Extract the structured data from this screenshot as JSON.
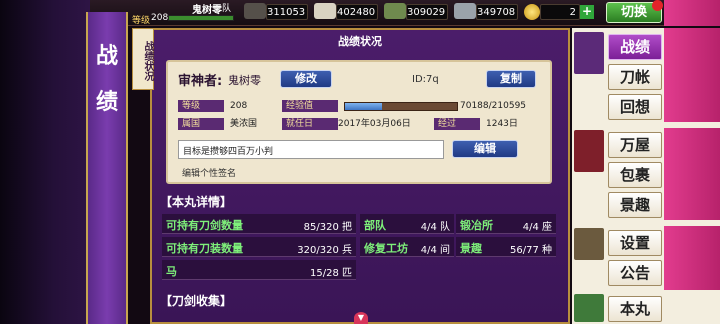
{
  "header": {
    "player_name": "鬼树零",
    "level_label": "等级",
    "level": "208",
    "resources": [
      "311053",
      "402480",
      "309029",
      "349708"
    ],
    "coins": "2",
    "switch_label": "切换"
  },
  "banner": {
    "line1": "战",
    "line2": "绩"
  },
  "panel": {
    "title": "战绩状况",
    "side_tag": "战绩状况"
  },
  "profile": {
    "name_label": "审神者:",
    "name": "鬼树零",
    "modify_button": "修改",
    "id": "ID:7q",
    "copy_button": "复制",
    "level_label": "等级",
    "level": "208",
    "exp_label": "经验值",
    "exp": "70188/210595",
    "exp_progress": 0.333,
    "country_label": "属国",
    "country": "美浓国",
    "appointed_label": "就任日",
    "appointed": "2017年03月06日",
    "elapsed_label": "经过",
    "elapsed": "1243日",
    "signature": "目标是攒够四百万小判",
    "edit_button": "编辑",
    "signature_hint": "编辑个性签名"
  },
  "details": {
    "section_title": "【本丸详情】",
    "rows": [
      {
        "key": "可持有刀剑数量",
        "value": "85/320 把"
      },
      {
        "key": "可持有刀装数量",
        "value": "320/320 兵"
      },
      {
        "key": "马",
        "value": "15/28 匹"
      }
    ],
    "rows2": [
      {
        "key": "部队",
        "value": "4/4 队"
      },
      {
        "key": "修复工坊",
        "value": "4/4 间"
      }
    ],
    "rows3": [
      {
        "key": "锻冶所",
        "value": "4/4 座"
      },
      {
        "key": "景趣",
        "value": "56/77 种"
      }
    ]
  },
  "collection": {
    "section_title": "【刀剑收集】"
  },
  "nav": [
    "战绩",
    "刀帐",
    "回想",
    "万屋",
    "包裹",
    "景趣",
    "设置",
    "公告",
    "本丸"
  ],
  "colors": {
    "accent": "#7c1f97",
    "green_text": "#7ef07a"
  }
}
